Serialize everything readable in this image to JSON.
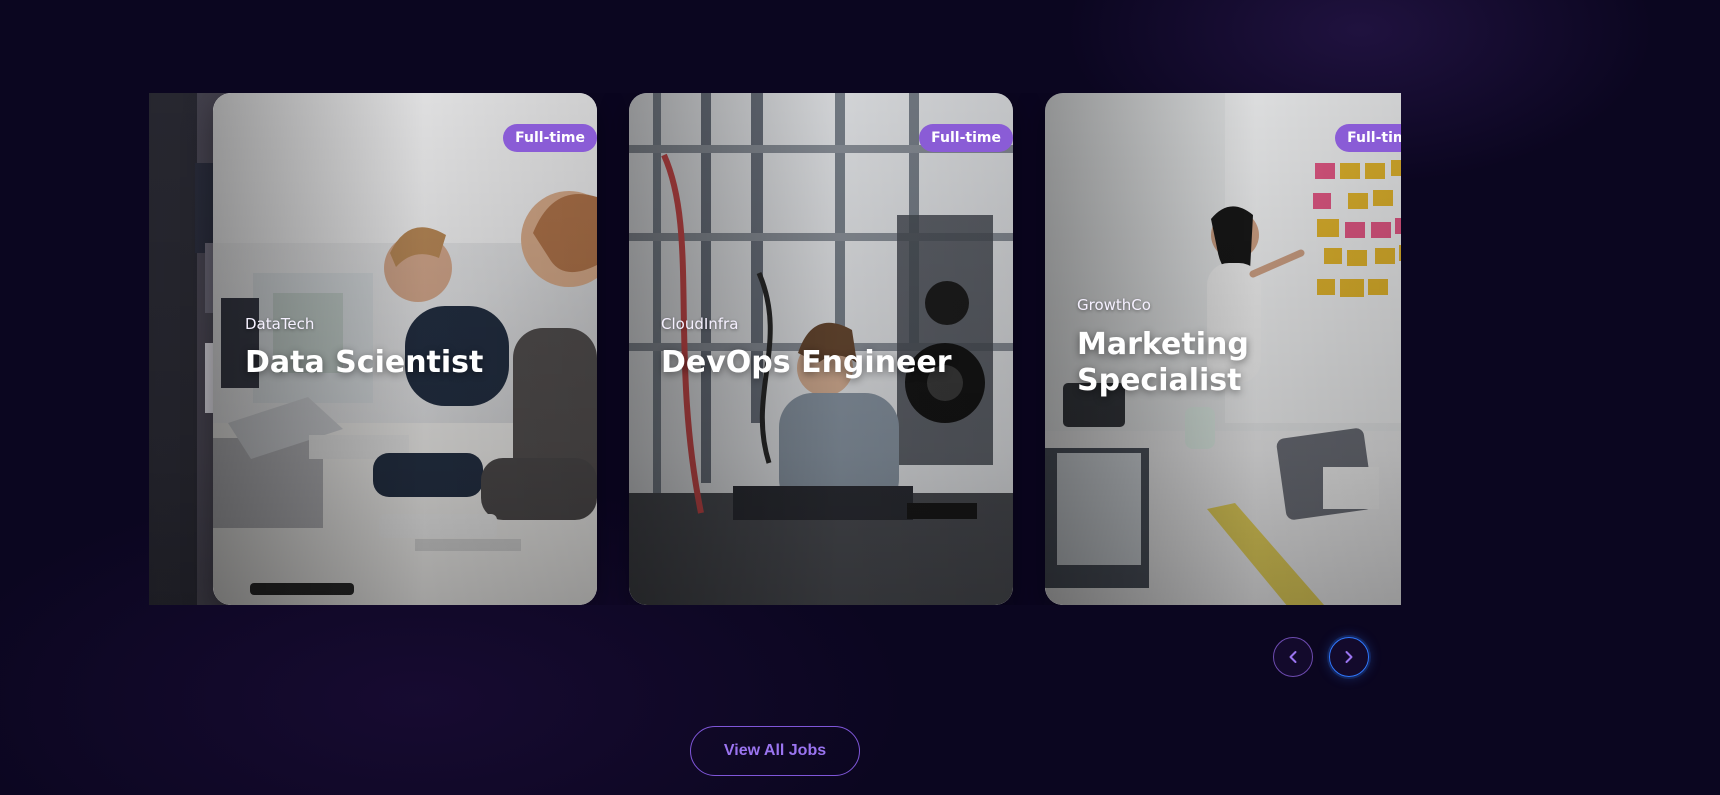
{
  "theme": {
    "background": "#0b0620",
    "badge": "#8a5cd6",
    "accent": "#9a74f0",
    "next_focus": "#2f78ff"
  },
  "jobs": [
    {
      "company": "",
      "title": "",
      "badge": "",
      "visual": "design-workstation"
    },
    {
      "company": "DataTech",
      "title": "Data Scientist",
      "badge": "Full-time",
      "visual": "office-desk"
    },
    {
      "company": "CloudInfra",
      "title": "DevOps Engineer",
      "badge": "Full-time",
      "visual": "lab-rack"
    },
    {
      "company": "GrowthCo",
      "title": "Marketing Specialist",
      "badge": "Full-time",
      "visual": "whiteboard-meeting"
    }
  ],
  "carousel": {
    "prev_label": "Previous",
    "next_label": "Next",
    "prev_icon": "chevron-left-icon",
    "next_icon": "chevron-right-icon"
  },
  "cta": {
    "label": "View All Jobs"
  }
}
